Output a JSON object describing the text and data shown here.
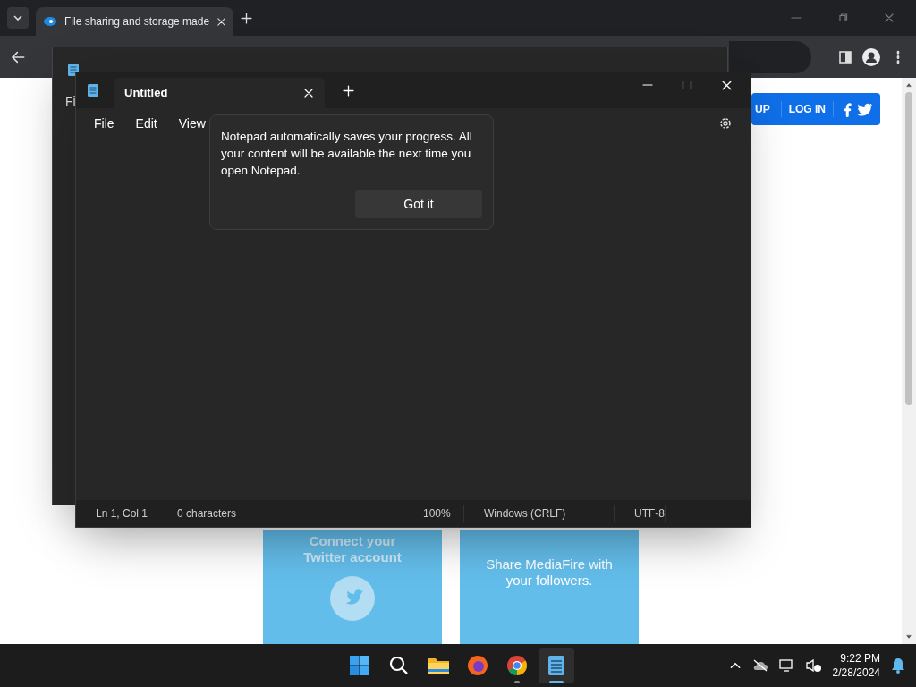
{
  "browser": {
    "tab_title": "File sharing and storage made",
    "page": {
      "header_buttons": [
        "UP",
        "LOG IN"
      ],
      "cards": [
        {
          "title": "Connect your Twitter account",
          "icon": true
        },
        {
          "title": "Share MediaFire with your followers.",
          "icon": false
        }
      ]
    }
  },
  "back_notepad": {
    "menu_first": "Fi"
  },
  "notepad": {
    "tab_title": "Untitled",
    "menu": [
      "File",
      "Edit",
      "View"
    ],
    "tip": {
      "text": "Notepad automatically saves your progress. All your content will be available the next time you open Notepad.",
      "button": "Got it"
    },
    "status_bar": [
      "Ln 1, Col 1",
      "0 characters",
      "100%",
      "Windows (CRLF)",
      "UTF-8"
    ]
  },
  "taskbar": {
    "apps": [
      {
        "kind": "start",
        "selected": false,
        "running": false
      },
      {
        "kind": "search",
        "selected": false,
        "running": false
      },
      {
        "kind": "files",
        "selected": false,
        "running": false
      },
      {
        "kind": "firefox",
        "selected": false,
        "running": false
      },
      {
        "kind": "chrome",
        "selected": false,
        "running": true
      },
      {
        "kind": "notepad",
        "selected": true,
        "running": true
      }
    ],
    "time": "9:22 PM",
    "date": "2/28/2024"
  }
}
